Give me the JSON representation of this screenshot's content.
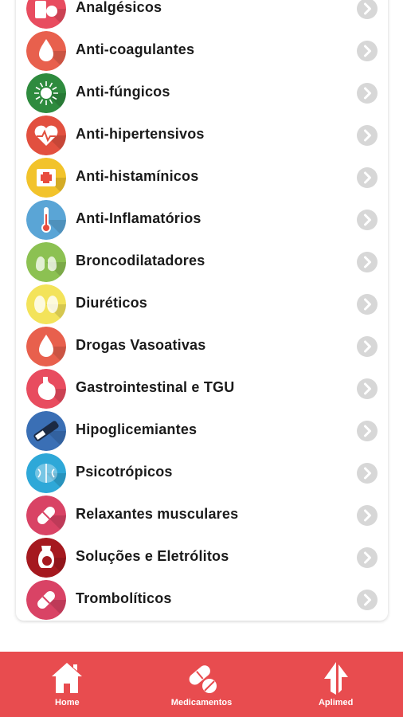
{
  "categories": [
    {
      "label": "Analgésicos",
      "icon": "pill-bottle-icon",
      "color": "#e84c5f"
    },
    {
      "label": "Anti-coagulantes",
      "icon": "blood-drop-icon",
      "color": "#e8604d"
    },
    {
      "label": "Anti-fúngicos",
      "icon": "fungus-icon",
      "color": "#2e8b3e"
    },
    {
      "label": "Anti-hipertensivos",
      "icon": "heart-pulse-icon",
      "color": "#e2503f"
    },
    {
      "label": "Anti-histamínicos",
      "icon": "medicine-box-icon",
      "color": "#f2c32b"
    },
    {
      "label": "Anti-Inflamatórios",
      "icon": "thermometer-icon",
      "color": "#5aa5d6"
    },
    {
      "label": "Broncodilatadores",
      "icon": "lungs-icon",
      "color": "#8cc152"
    },
    {
      "label": "Diuréticos",
      "icon": "kidneys-icon",
      "color": "#f3e35a"
    },
    {
      "label": "Drogas Vasoativas",
      "icon": "blood-drop-icon",
      "color": "#e8604d"
    },
    {
      "label": "Gastrointestinal e TGU",
      "icon": "stomach-icon",
      "color": "#e84c5f"
    },
    {
      "label": "Hipoglicemiantes",
      "icon": "insulin-pen-icon",
      "color": "#3a6fb5"
    },
    {
      "label": "Psicotrópicos",
      "icon": "brain-icon",
      "color": "#2ea8d8"
    },
    {
      "label": "Relaxantes musculares",
      "icon": "capsule-icon",
      "color": "#d94365"
    },
    {
      "label": "Soluções e Eletrólitos",
      "icon": "solution-flask-icon",
      "color": "#a5191f"
    },
    {
      "label": "Trombolíticos",
      "icon": "capsule-icon",
      "color": "#d94365"
    }
  ],
  "tabbar": {
    "color": "#e84c4f",
    "tabs": [
      {
        "label": "Home",
        "icon": "home-icon"
      },
      {
        "label": "Medicamentos",
        "icon": "pills-icon"
      },
      {
        "label": "Aplimed",
        "icon": "aplimed-logo-icon"
      }
    ]
  }
}
